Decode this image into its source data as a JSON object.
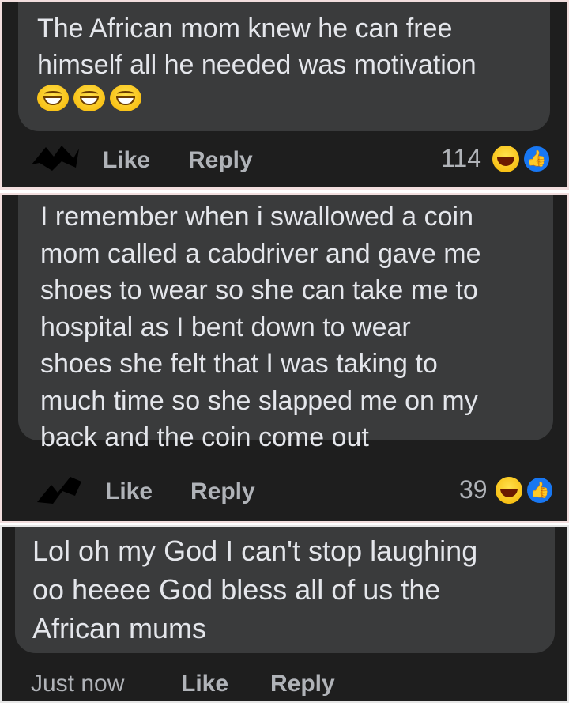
{
  "comment1": {
    "text_line1": "The African mom knew he can free",
    "text_line2": "himself all he needed was motivation",
    "emojis": [
      "grinning-squinting-face",
      "grinning-squinting-face",
      "grinning-squinting-face"
    ],
    "like_label": "Like",
    "reply_label": "Reply",
    "reaction_count": "114"
  },
  "comment2": {
    "lines": [
      "I remember when i swallowed a coin",
      "mom called a cabdriver and gave me",
      "shoes to wear so she can take me to",
      "hospital as I bent down to wear",
      "shoes she felt that I was taking to",
      "much time so she slapped me on my",
      "back and the coin come out"
    ],
    "like_label": "Like",
    "reply_label": "Reply",
    "reaction_count": "39"
  },
  "comment3": {
    "lines": [
      "Lol oh my God I can't stop laughing",
      "oo heeee God bless all of us the",
      "African mums"
    ],
    "timestamp": "Just now",
    "like_label": "Like",
    "reply_label": "Reply"
  },
  "colors": {
    "background": "#1e1e1e",
    "bubble": "#3a3b3c",
    "text": "#e4e6eb",
    "muted": "#b0b3b8",
    "like_blue": "#1877f2",
    "haha_yellow": "#f5b400"
  },
  "icons": {
    "reaction_haha": "haha-face-icon",
    "reaction_like": "thumbs-up-icon",
    "redacted_timestamp": "scribble-redaction"
  }
}
